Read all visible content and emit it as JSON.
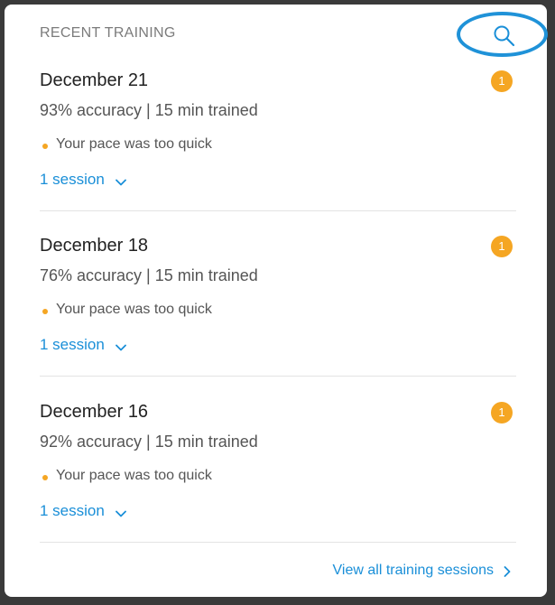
{
  "header": {
    "title": "RECENT TRAINING"
  },
  "sessions": [
    {
      "date": "December 21",
      "stats": "93% accuracy | 15 min trained",
      "note": "Your pace was too quick",
      "toggle_label": "1 session",
      "badge": "1"
    },
    {
      "date": "December 18",
      "stats": "76% accuracy | 15 min trained",
      "note": "Your pace was too quick",
      "toggle_label": "1 session",
      "badge": "1"
    },
    {
      "date": "December 16",
      "stats": "92% accuracy | 15 min trained",
      "note": "Your pace was too quick",
      "toggle_label": "1 session",
      "badge": "1"
    }
  ],
  "footer": {
    "view_all_label": "View all training sessions"
  },
  "colors": {
    "accent": "#1a8fd8",
    "badge": "#f5a623",
    "highlight_ring": "#1f92d8"
  },
  "icons": {
    "search": "search-icon",
    "expand": "chevron-down-icon",
    "forward": "chevron-right-icon"
  }
}
